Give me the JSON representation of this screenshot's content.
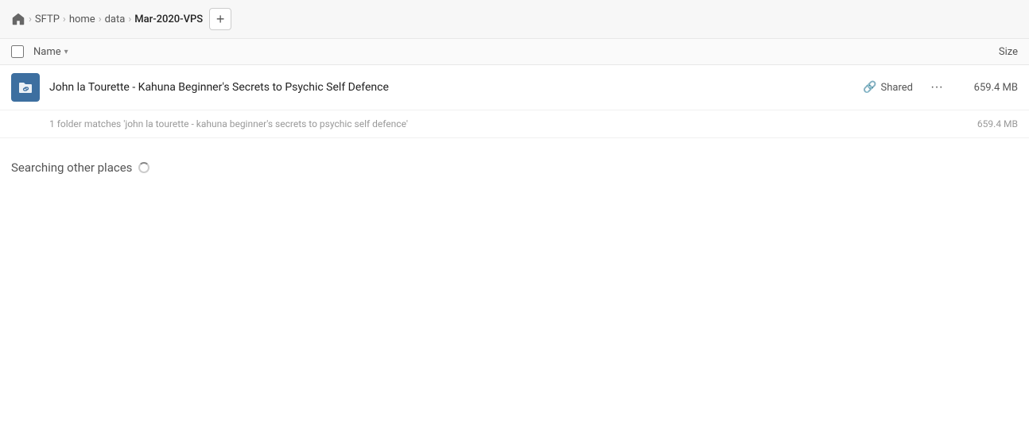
{
  "breadcrumb": {
    "home_label": "home",
    "items": [
      {
        "id": "home",
        "label": "SFTP"
      },
      {
        "id": "home-dir",
        "label": "home"
      },
      {
        "id": "data",
        "label": "data"
      },
      {
        "id": "mar2020vps",
        "label": "Mar-2020-VPS"
      }
    ],
    "add_tab_label": "+"
  },
  "column_header": {
    "name_label": "Name",
    "sort_arrow": "▾",
    "size_label": "Size"
  },
  "file_row": {
    "icon_type": "folder-link",
    "name": "John la Tourette - Kahuna Beginner's Secrets to Psychic Self Defence",
    "shared_label": "Shared",
    "more_label": "•••",
    "size": "659.4 MB"
  },
  "match_info": {
    "text": "1 folder matches 'john la tourette - kahuna beginner's secrets to psychic self defence'",
    "size": "659.4 MB"
  },
  "searching_section": {
    "label": "Searching other places"
  }
}
